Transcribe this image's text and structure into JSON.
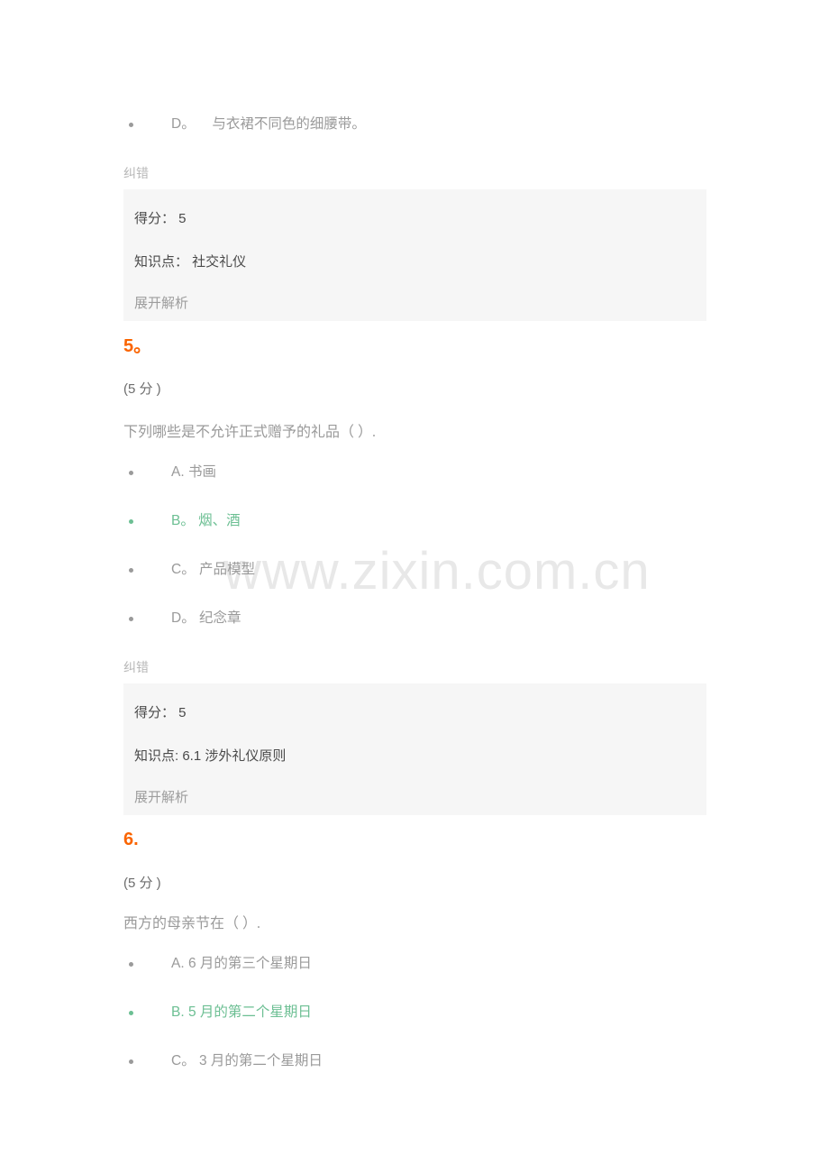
{
  "watermark": {
    "text": "www.zixin.com.cn"
  },
  "labels": {
    "report_error": "纠错",
    "score_label": "得分：",
    "expand_analysis": "展开解析"
  },
  "trailing_question": {
    "last_option": {
      "letter": "D。",
      "text": "与衣裙不同色的细腰带。",
      "correct": false
    },
    "report_error": "纠错",
    "panel": {
      "score_line": "得分： 5",
      "knowledge_line": "知识点： 社交礼仪",
      "expand": "展开解析"
    }
  },
  "questions": [
    {
      "number": "5。",
      "points": "(5 分 )",
      "stem": "下列哪些是不允许正式赠予的礼品（ ）.",
      "options": [
        {
          "letter": "A.",
          "text": "书画",
          "correct": false,
          "display": "A. 书画"
        },
        {
          "letter": "B。",
          "text": "烟、酒",
          "correct": true,
          "display": "B。 烟、酒"
        },
        {
          "letter": "C。",
          "text": "产品模型",
          "correct": false,
          "display": "C。 产品模型"
        },
        {
          "letter": "D。",
          "text": "纪念章",
          "correct": false,
          "display": "D。 纪念章"
        }
      ],
      "report_error": "纠错",
      "panel": {
        "score_line": "得分： 5",
        "knowledge_line": "知识点: 6.1 涉外礼仪原则",
        "expand": "展开解析"
      }
    },
    {
      "number": "6.",
      "points": "(5 分 )",
      "stem": "西方的母亲节在（ ）.",
      "options": [
        {
          "letter": "A.",
          "text": "6 月的第三个星期日",
          "correct": false,
          "display": "A. 6 月的第三个星期日"
        },
        {
          "letter": "B.",
          "text": "5 月的第二个星期日",
          "correct": true,
          "display": "B. 5 月的第二个星期日"
        },
        {
          "letter": "C。",
          "text": "3 月的第二个星期日",
          "correct": false,
          "display": "C。 3 月的第二个星期日"
        }
      ]
    }
  ],
  "colors": {
    "accent_orange": "#fa6400",
    "correct_green": "#6cbf93",
    "panel_bg": "#f6f6f6",
    "body_text": "#9a9a9a",
    "muted_text": "#b8b8b8",
    "watermark": "#e8e8e8"
  }
}
